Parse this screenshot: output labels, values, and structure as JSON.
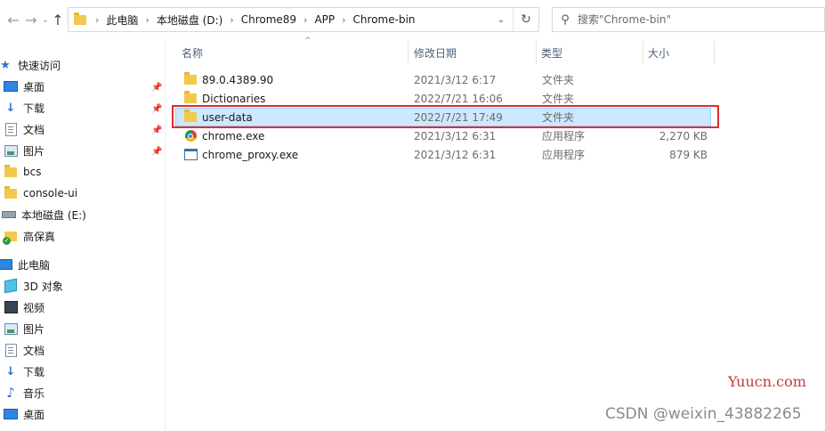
{
  "nav": {
    "back_icon": "arrow-left",
    "forward_icon": "arrow-right",
    "recent_icon": "chevron-down",
    "up_icon": "arrow-up"
  },
  "address_bar": {
    "breadcrumbs": [
      "此电脑",
      "本地磁盘 (D:)",
      "Chrome89",
      "APP",
      "Chrome-bin"
    ]
  },
  "search": {
    "placeholder": "搜索\"Chrome-bin\""
  },
  "sidebar": {
    "items": [
      {
        "label": "快速访问",
        "icon": "star-icon"
      },
      {
        "label": "桌面",
        "icon": "desktop-icon",
        "pinned": true
      },
      {
        "label": "下载",
        "icon": "download-icon",
        "pinned": true
      },
      {
        "label": "文档",
        "icon": "document-icon",
        "pinned": true
      },
      {
        "label": "图片",
        "icon": "pictures-icon",
        "pinned": true
      },
      {
        "label": "bcs",
        "icon": "folder-icon"
      },
      {
        "label": "console-ui",
        "icon": "folder-icon"
      },
      {
        "label": "本地磁盘 (E:)",
        "icon": "drive-icon"
      },
      {
        "label": "高保真",
        "icon": "folder-synced-icon"
      },
      {
        "label": "此电脑",
        "icon": "computer-icon"
      },
      {
        "label": "3D 对象",
        "icon": "3d-objects-icon"
      },
      {
        "label": "视频",
        "icon": "video-icon"
      },
      {
        "label": "图片",
        "icon": "pictures-icon"
      },
      {
        "label": "文档",
        "icon": "document-icon"
      },
      {
        "label": "下载",
        "icon": "download-icon"
      },
      {
        "label": "音乐",
        "icon": "music-icon"
      },
      {
        "label": "桌面",
        "icon": "desktop-icon"
      }
    ]
  },
  "columns": {
    "name": "名称",
    "modified": "修改日期",
    "type": "类型",
    "size": "大小"
  },
  "files": [
    {
      "name": "89.0.4389.90",
      "modified": "2021/3/12 6:17",
      "type": "文件夹",
      "size": "",
      "icon": "folder-icon"
    },
    {
      "name": "Dictionaries",
      "modified": "2022/7/21 16:06",
      "type": "文件夹",
      "size": "",
      "icon": "folder-icon"
    },
    {
      "name": "user-data",
      "modified": "2022/7/21 17:49",
      "type": "文件夹",
      "size": "",
      "icon": "folder-icon",
      "selected": true
    },
    {
      "name": "chrome.exe",
      "modified": "2021/3/12 6:31",
      "type": "应用程序",
      "size": "2,270 KB",
      "icon": "chrome-icon"
    },
    {
      "name": "chrome_proxy.exe",
      "modified": "2021/3/12 6:31",
      "type": "应用程序",
      "size": "879 KB",
      "icon": "exe-icon"
    }
  ],
  "annotation": {
    "highlight_color": "#e02d2d"
  },
  "watermarks": {
    "site": "Yuucn.com",
    "author": "CSDN @weixin_43882265"
  },
  "colors": {
    "selection_bg": "#cce8ff",
    "selection_border": "#99d1ff",
    "folder": "#f2c94c",
    "header_text": "#4c607a"
  }
}
